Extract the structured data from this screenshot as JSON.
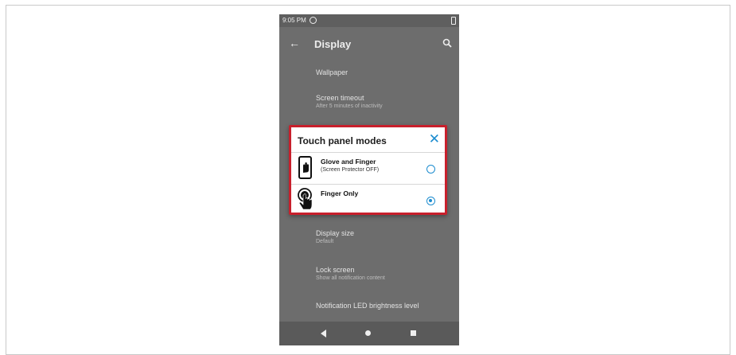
{
  "status_bar": {
    "time": "9:05 PM"
  },
  "app_bar": {
    "title": "Display"
  },
  "settings": [
    {
      "title": "Wallpaper",
      "summary": ""
    },
    {
      "title": "Screen timeout",
      "summary": "After 5 minutes of inactivity"
    },
    {
      "title": "Display size",
      "summary": "Default"
    },
    {
      "title": "Lock screen",
      "summary": "Show all notification content"
    },
    {
      "title": "Notification LED brightness level",
      "summary": ""
    }
  ],
  "dialog": {
    "title": "Touch panel modes",
    "options": [
      {
        "title": "Glove and Finger",
        "subtitle": "(Screen Protector OFF)",
        "selected": false,
        "icon": "glove-hand-phone-icon"
      },
      {
        "title": "Finger Only",
        "subtitle": "",
        "selected": true,
        "icon": "finger-touch-icon"
      }
    ]
  },
  "colors": {
    "accent": "#1c8ccf",
    "highlight_border": "#c8202c",
    "scrim": "#6d6d6d"
  }
}
